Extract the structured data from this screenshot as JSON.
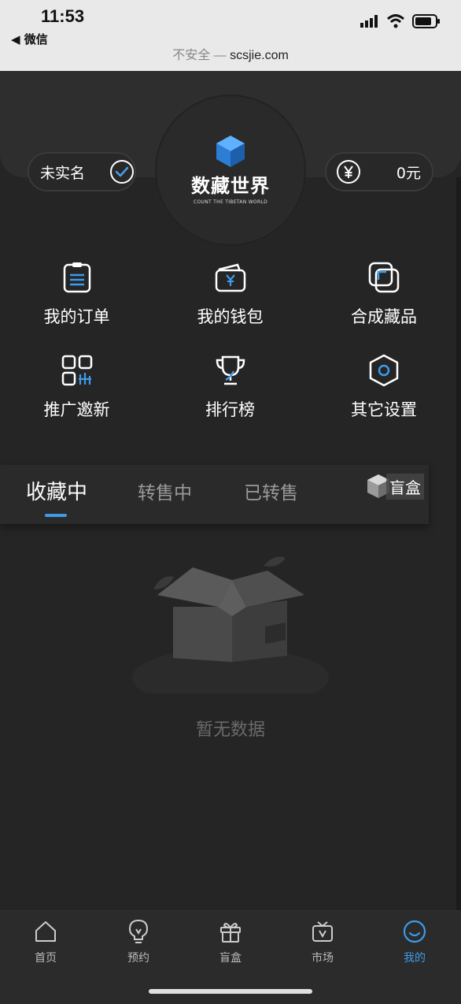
{
  "status_bar": {
    "time": "11:53",
    "back_app": "◀ 微信",
    "url_insecure": "不安全 — ",
    "url_host": "scsjie.com"
  },
  "logo": {
    "title": "数藏世界",
    "subtitle": "COUNT THE TIBETAN WORLD"
  },
  "verify_pill": {
    "label": "未实名"
  },
  "balance_pill": {
    "amount": "0元"
  },
  "grid": [
    {
      "label": "我的订单",
      "icon": "order-icon"
    },
    {
      "label": "我的钱包",
      "icon": "wallet-icon"
    },
    {
      "label": "合成藏品",
      "icon": "compose-icon"
    },
    {
      "label": "推广邀新",
      "icon": "invite-icon"
    },
    {
      "label": "排行榜",
      "icon": "trophy-icon"
    },
    {
      "label": "其它设置",
      "icon": "settings-icon"
    }
  ],
  "tabs": [
    {
      "label": "收藏中",
      "active": true
    },
    {
      "label": "转售中",
      "active": false
    },
    {
      "label": "已转售",
      "active": false
    }
  ],
  "blind_box_tag": "盲盒",
  "empty": {
    "text": "暂无数据"
  },
  "bottom_nav": [
    {
      "label": "首页",
      "icon": "home-icon"
    },
    {
      "label": "预约",
      "icon": "bulb-icon"
    },
    {
      "label": "盲盒",
      "icon": "gift-icon"
    },
    {
      "label": "市场",
      "icon": "market-icon"
    },
    {
      "label": "我的",
      "icon": "smile-icon",
      "active": true
    }
  ],
  "colors": {
    "accent": "#3d9be9",
    "background": "#252525"
  }
}
